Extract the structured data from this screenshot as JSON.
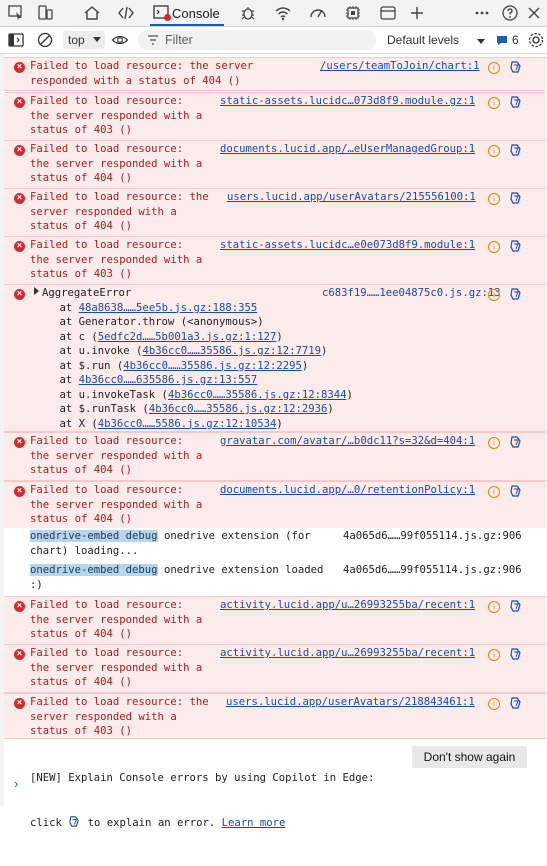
{
  "tabs": {
    "console_label": "Console",
    "icons": [
      "inspect-icon",
      "device-icon",
      "home-icon",
      "elements-icon",
      "console-icon",
      "debug-icon",
      "network-icon",
      "performance-icon",
      "memory-icon",
      "application-icon",
      "add-icon",
      "more-icon",
      "help-icon",
      "close-icon"
    ]
  },
  "toolbar": {
    "context": "top",
    "filter_placeholder": "Filter",
    "levels": "Default levels",
    "issues_count": "6"
  },
  "messages": [
    {
      "type": "error",
      "lines": [
        "Failed to load resource: the server",
        "responded with a status of 404 ()"
      ],
      "source": "/users/teamToJoin/chart:1"
    },
    {
      "type": "error",
      "lines": [
        "Failed to load resource:",
        "the server responded with a",
        "status of 403 ()"
      ],
      "source": "static-assets.lucidc…073d8f9.module.gz:1"
    },
    {
      "type": "error",
      "lines": [
        "Failed to load resource:",
        "the server responded with a",
        "status of 404 ()"
      ],
      "source": "documents.lucid.app/…eUserManagedGroup:1"
    },
    {
      "type": "error",
      "lines": [
        "Failed to load resource: the",
        "server responded with a",
        "status of 404 ()"
      ],
      "source": "users.lucid.app/userAvatars/215556100:1"
    },
    {
      "type": "error",
      "lines": [
        "Failed to load resource:",
        "the server responded with a",
        "status of 403 ()"
      ],
      "source": "static-assets.lucidc…e0e073d8f9.module:1"
    },
    {
      "type": "stack",
      "title": "AggregateError",
      "source": "c683f19……1ee04875c0.js.gz:13",
      "frames": [
        {
          "pre": "    at ",
          "link": "48a8638……5ee5b.js.gz:188:355",
          "post": ""
        },
        {
          "pre": "    at Generator.throw (<anonymous>)",
          "link": "",
          "post": ""
        },
        {
          "pre": "    at c (",
          "link": "5edfc2d……5b001a3.js.gz:1:127",
          "post": ")"
        },
        {
          "pre": "    at u.invoke (",
          "link": "4b36cc0……35586.js.gz:12:7719",
          "post": ")"
        },
        {
          "pre": "    at $.run (",
          "link": "4b36cc0……35586.js.gz:12:2295",
          "post": ")"
        },
        {
          "pre": "    at ",
          "link": "4b36cc0……635586.js.gz:13:557",
          "post": ""
        },
        {
          "pre": "    at u.invokeTask (",
          "link": "4b36cc0……35586.js.gz:12:8344",
          "post": ")"
        },
        {
          "pre": "    at $.runTask (",
          "link": "4b36cc0……35586.js.gz:12:2936",
          "post": ")"
        },
        {
          "pre": "    at X (",
          "link": "4b36cc0……5586.js.gz:12:10534",
          "post": ")"
        }
      ]
    },
    {
      "type": "error",
      "lines": [
        "Failed to load resource:",
        "the server responded with a",
        "status of 404 ()"
      ],
      "source": "gravatar.com/avatar/…b0dc11?s=32&d=404:1"
    },
    {
      "type": "error",
      "lines": [
        "Failed to load resource:",
        "the server responded with a",
        "status of 404 ()"
      ],
      "source": "documents.lucid.app/…0/retentionPolicy:1"
    },
    {
      "type": "info",
      "badge": "onedrive-embed debug",
      "lines": [
        " onedrive extension (for",
        "chart) loading..."
      ],
      "source": "4a065d6……99f055114.js.gz:906"
    },
    {
      "type": "info",
      "badge": "onedrive-embed debug",
      "lines": [
        " onedrive extension loaded",
        ":)"
      ],
      "source": "4a065d6……99f055114.js.gz:906"
    },
    {
      "type": "error",
      "lines": [
        "Failed to load resource:",
        "the server responded with a",
        "status of 404 ()"
      ],
      "source": "activity.lucid.app/u…26993255ba/recent:1"
    },
    {
      "type": "error",
      "lines": [
        "Failed to load resource:",
        "the server responded with a",
        "status of 404 ()"
      ],
      "source": "activity.lucid.app/u…26993255ba/recent:1"
    },
    {
      "type": "error",
      "lines": [
        "Failed to load resource: the",
        "server responded with a",
        "status of 403 ()"
      ],
      "source": "users.lucid.app/userAvatars/218843461:1"
    }
  ],
  "copilot_notice": {
    "line1": "[NEW] Explain Console errors by using Copilot in Edge:",
    "line2_pre": "click ",
    "line2_post": " to explain an error. ",
    "learn_more": "Learn more",
    "dismiss": "Don't show again"
  },
  "prompt_symbol": "›"
}
